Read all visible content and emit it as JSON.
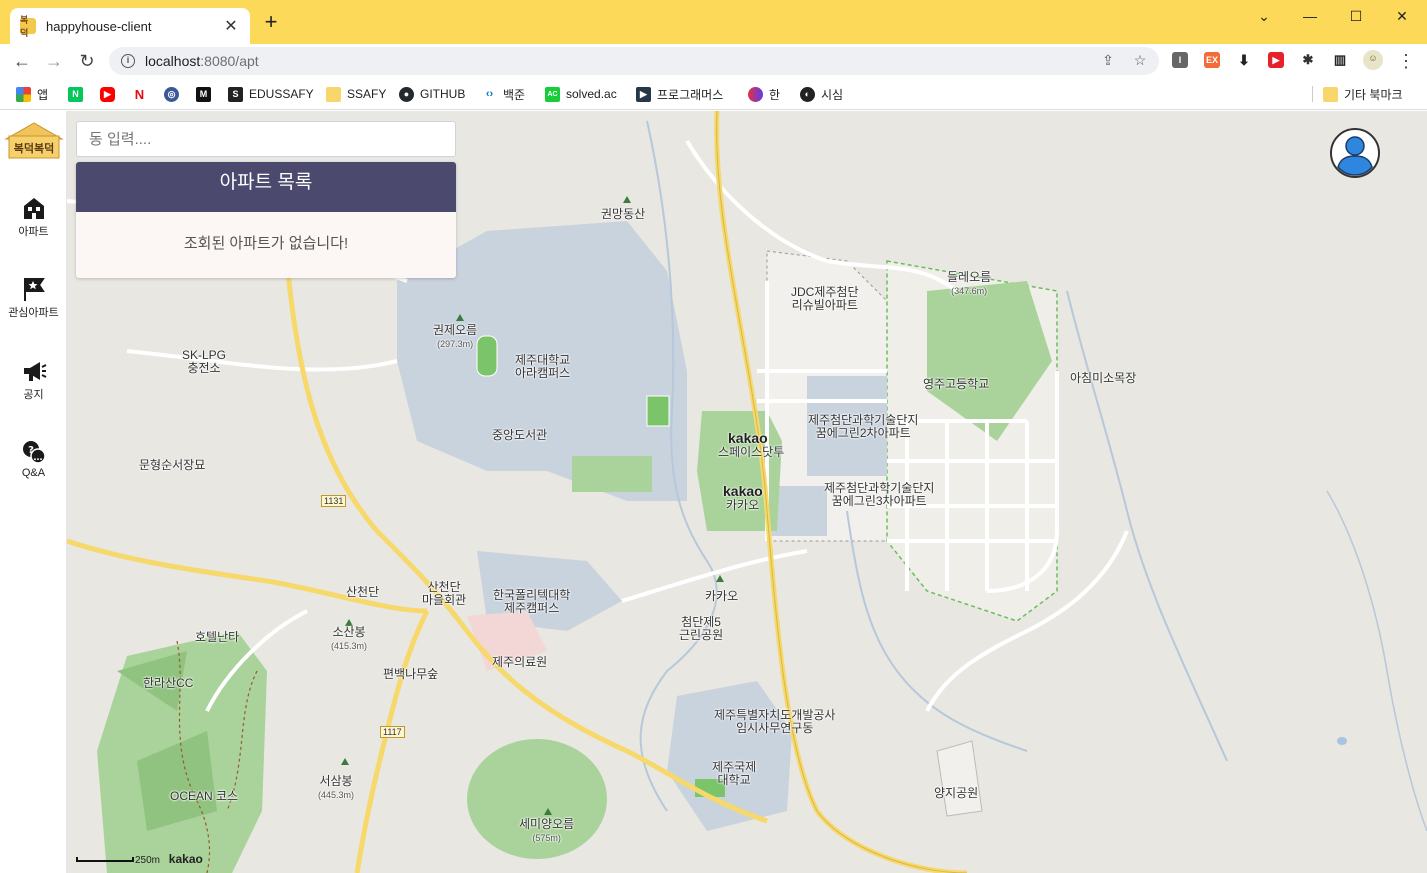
{
  "browser": {
    "tab_title": "happyhouse-client",
    "favicon_text": "복덕",
    "url_host": "localhost",
    "url_path": ":8080/apt",
    "bookmarks": [
      {
        "label": "앱",
        "color": "#e94235"
      },
      {
        "label": "",
        "color": "#03c75a",
        "glyph": "N"
      },
      {
        "label": "",
        "color": "#ff0000",
        "glyph": "▶"
      },
      {
        "label": "",
        "color": "#e50914",
        "glyph": "N"
      },
      {
        "label": "",
        "color": "#3b5998",
        "glyph": "◎"
      },
      {
        "label": "",
        "color": "#111111",
        "glyph": "M"
      },
      {
        "label": "EDUSSAFY",
        "color": "#222222",
        "glyph": "S"
      },
      {
        "label": "SSAFY",
        "color": "#f8d66c",
        "glyph": ""
      },
      {
        "label": "GITHUB",
        "color": "#24292e",
        "glyph": "●"
      },
      {
        "label": "백준",
        "color": "#0076c0",
        "glyph": "‹›"
      },
      {
        "label": "solved.ac",
        "color": "#17ce3a",
        "glyph": "AC"
      },
      {
        "label": "프로그래머스",
        "color": "#263747",
        "glyph": "▶"
      },
      {
        "label": "한",
        "color": "#7a3cf0",
        "glyph": "●"
      },
      {
        "label": "시심",
        "color": "#222222",
        "glyph": "◐"
      }
    ],
    "other_bookmarks": "기타 북마크",
    "window_controls": [
      "⌄",
      "—",
      "☐",
      "✕"
    ]
  },
  "sidebar": {
    "logo_text": "복덕복덕",
    "items": [
      {
        "label": "아파트",
        "icon": "building-icon"
      },
      {
        "label": "관심아파트",
        "icon": "star-flag-icon"
      },
      {
        "label": "공지",
        "icon": "megaphone-icon"
      },
      {
        "label": "Q&A",
        "icon": "qna-icon"
      }
    ]
  },
  "search": {
    "placeholder": "동 입력...."
  },
  "apt_list": {
    "title": "아파트 목록",
    "empty_message": "조회된 아파트가 없습니다!"
  },
  "map": {
    "labels": {
      "gwonmang": "권망동산",
      "deulle": "들레오름",
      "deulle_h": "(347.6m)",
      "jdc": "JDC제주첨단",
      "jdc2": "리슈빌아파트",
      "gwonje": "권제오름",
      "gwonje_h": "(297.3m)",
      "jnu": "제주대학교",
      "jnu2": "아라캠퍼스",
      "youngju": "영주고등학교",
      "achim": "아침미소목장",
      "sklpg": "SK-LPG",
      "sklpg2": "충전소",
      "library": "중앙도서관",
      "adv2": "제주첨단과학기술단지",
      "adv2b": "꿈에그린2차아파트",
      "kakao_space": "스페이스닷투",
      "kakao_co": "카카오",
      "adv3": "제주첨단과학기술단지",
      "adv3b": "꿈에그린3차아파트",
      "munhyeong": "문형순서장묘",
      "sancheon_hall": "산천단",
      "sancheon_hall2": "마을회관",
      "sancheondan": "산천단",
      "polytech": "한국폴리텍대학",
      "polytech2": "제주캠퍼스",
      "kakao_sub": "카카오",
      "park5": "첨단제5",
      "park5b": "근린공원",
      "hotel": "호텔난타",
      "sosan": "소산봉",
      "sosan_h": "(415.3m)",
      "jeju_medical": "제주의료원",
      "pyeonbaek": "편백나무숲",
      "hallasan_cc": "한라산CC",
      "jdc_office": "제주특별자치도개발공사",
      "jdc_office2": "임시사무연구동",
      "jiu": "제주국제",
      "jiu2": "대학교",
      "yangji": "양지공원",
      "seosam": "서삼봉",
      "seosam_h": "(445.3m)",
      "ocean": "OCEAN 코스",
      "semiyang": "세미양오름",
      "semiyang_h": "(575m)",
      "road_1131": "1131",
      "road_1117": "1117"
    },
    "kakao_marks": [
      "kakao",
      "kakao"
    ],
    "scale_label": "250m",
    "brand": "kakao"
  },
  "colors": {
    "panel_header": "#4b4a6e",
    "panel_body": "#fcf6f5",
    "titlebar": "#fdd95a",
    "campus": "#c9d3de",
    "green": "#a9d39a",
    "road_main": "#f7d86b"
  }
}
